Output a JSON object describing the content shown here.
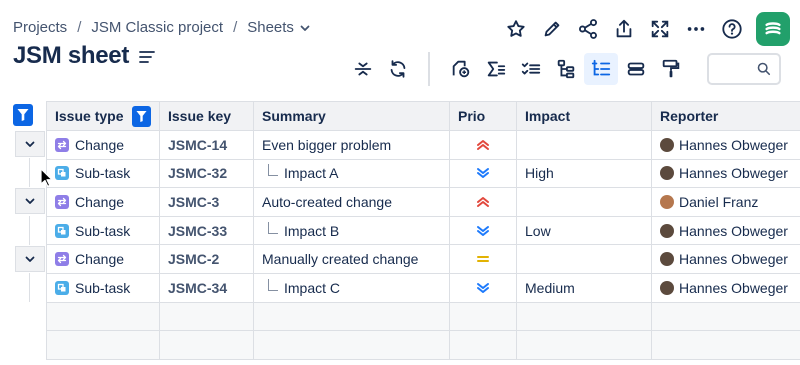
{
  "breadcrumb": {
    "items": [
      "Projects",
      "JSM Classic project",
      "Sheets"
    ],
    "separator": "/"
  },
  "page": {
    "title": "JSM sheet"
  },
  "top_actions": [
    "star-icon",
    "edit-icon",
    "share-icon",
    "export-icon",
    "fullscreen-icon",
    "more-icon",
    "help-icon",
    "app-logo"
  ],
  "toolbar": {
    "buttons": [
      "collapse-rows-icon",
      "refresh-icon",
      "add-view-icon",
      "sum-icon",
      "checklist-icon",
      "hierarchy-icon",
      "tree-view-icon",
      "group-rows-icon",
      "format-painter-icon"
    ],
    "active_button": "tree-view-icon",
    "search": {
      "value": "",
      "placeholder": ""
    }
  },
  "table": {
    "columns": [
      "Issue type",
      "Issue key",
      "Summary",
      "Prio",
      "Impact",
      "Reporter"
    ],
    "rows": [
      {
        "type": "Change",
        "type_icon": "change-icon",
        "key": "JSMC-14",
        "summary": "Even bigger problem",
        "child": false,
        "prio": "highest",
        "impact": "",
        "reporter": "Hannes Obweger",
        "avatar_color": "#5c4a3d"
      },
      {
        "type": "Sub-task",
        "type_icon": "subtask-icon",
        "key": "JSMC-32",
        "summary": "Impact A",
        "child": true,
        "prio": "lowest",
        "impact": "High",
        "reporter": "Hannes Obweger",
        "avatar_color": "#5c4a3d"
      },
      {
        "type": "Change",
        "type_icon": "change-icon",
        "key": "JSMC-3",
        "summary": "Auto-created change",
        "child": false,
        "prio": "highest",
        "impact": "",
        "reporter": "Daniel Franz",
        "avatar_color": "#b5774e"
      },
      {
        "type": "Sub-task",
        "type_icon": "subtask-icon",
        "key": "JSMC-33",
        "summary": "Impact B",
        "child": true,
        "prio": "lowest",
        "impact": "Low",
        "reporter": "Hannes Obweger",
        "avatar_color": "#5c4a3d"
      },
      {
        "type": "Change",
        "type_icon": "change-icon",
        "key": "JSMC-2",
        "summary": "Manually created change",
        "child": false,
        "prio": "medium",
        "impact": "",
        "reporter": "Hannes Obweger",
        "avatar_color": "#5c4a3d"
      },
      {
        "type": "Sub-task",
        "type_icon": "subtask-icon",
        "key": "JSMC-34",
        "summary": "Impact C",
        "child": true,
        "prio": "lowest",
        "impact": "Medium",
        "reporter": "Hannes Obweger",
        "avatar_color": "#5c4a3d"
      }
    ],
    "empty_rows": 2
  },
  "colors": {
    "accent": "#0c66e4",
    "prio_highest": "#e2483d",
    "prio_medium": "#e2b203",
    "prio_lowest": "#1d7afc",
    "change_icon": "#8f7ee7",
    "subtask_icon": "#4bade8",
    "logo": "#22a06b"
  }
}
